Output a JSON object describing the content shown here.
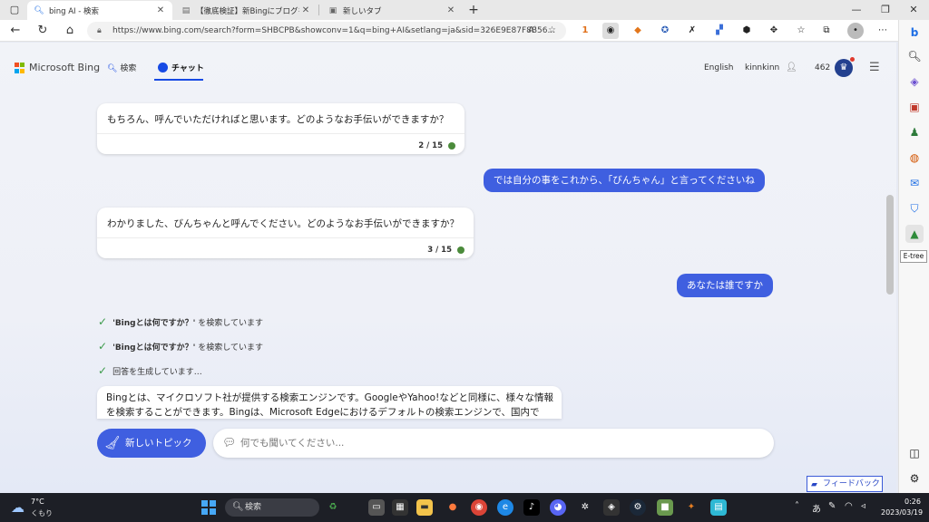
{
  "browser": {
    "tabs": [
      {
        "title": "bing AI - 検索",
        "icon": "bing-search-icon"
      },
      {
        "title": "【徹底検証】新Bingにブログを書かせ",
        "icon": "page-icon"
      },
      {
        "title": "新しいタブ",
        "icon": "new-tab-page-icon"
      }
    ],
    "new_tab_glyph": "+",
    "url": "https://www.bing.com/search?form=SHBCPB&showconv=1&q=bing+AI&setlang=ja&sid=326E9E87F8B56...",
    "extension_badge": "1"
  },
  "sidebar": {
    "tooltip": "E-tree",
    "icons": [
      "bing-icon",
      "search-icon",
      "tag-icon",
      "briefcase-icon",
      "games-icon",
      "office-icon",
      "outlook-icon",
      "shopping-icon",
      "e-tree-icon",
      "split-screen-icon",
      "settings-icon"
    ]
  },
  "bing": {
    "brand": "Microsoft Bing",
    "nav_search": "検索",
    "nav_chat": "チャット",
    "language": "English",
    "user": "kinnkinn",
    "points": "462",
    "brand_colors": {
      "red": "#f25022",
      "green": "#7fba00",
      "blue": "#00a4ef",
      "yellow": "#ffb900"
    }
  },
  "chat": {
    "messages": [
      {
        "role": "bot",
        "text": "もちろん、呼んでいただければと思います。どのようなお手伝いができますか？",
        "count": "2 / 15"
      },
      {
        "role": "user",
        "text": "では自分の事をこれから、「びんちゃん」と言ってくださいね"
      },
      {
        "role": "bot",
        "text": "わかりました、びんちゃんと呼んでください。どのようなお手伝いができますか？",
        "count": "3 / 15"
      },
      {
        "role": "user",
        "text": "あなたは誰ですか"
      }
    ],
    "status": [
      {
        "bold": "'Bingとは何ですか？'",
        "rest": " を検索しています"
      },
      {
        "bold": "'Bingとは何ですか？'",
        "rest": " を検索しています"
      },
      {
        "bold": "",
        "rest": "回答を生成しています…"
      }
    ],
    "answer": "Bingとは、マイクロソフト社が提供する検索エンジンです。GoogleやYahoo!などと同様に、様々な情報を検索することができます。Bingは、Microsoft Edgeにおけるデフォルトの検索エンジンで、国内で",
    "new_topic": "新しいトピック",
    "input_placeholder": "何でも聞いてください...",
    "feedback": "フィードバック"
  },
  "taskbar": {
    "weather_temp": "7°C",
    "weather_desc": "くもり",
    "search_label": "検索",
    "time": "0:26",
    "date": "2023/03/19",
    "ime": "あ"
  }
}
